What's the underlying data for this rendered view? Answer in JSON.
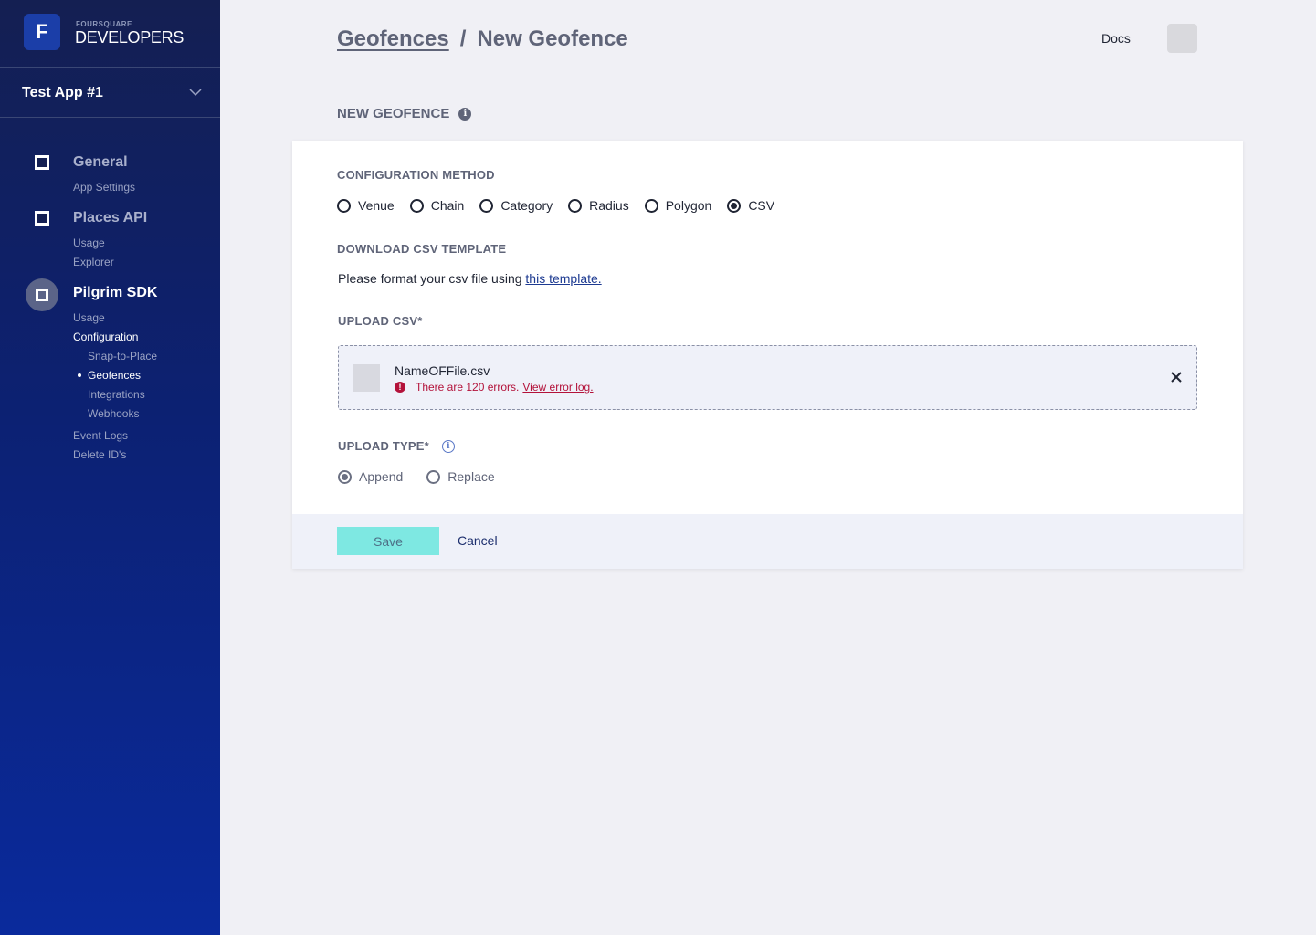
{
  "brand": {
    "logo_letter": "F",
    "small_text": "FOURSQUARE",
    "big_text": "DEVELOPERS"
  },
  "app_selector": {
    "label": "Test App #1"
  },
  "sidebar": {
    "general": {
      "title": "General",
      "items": [
        "App Settings"
      ]
    },
    "places": {
      "title": "Places API",
      "items": [
        "Usage",
        "Explorer"
      ]
    },
    "pilgrim": {
      "title": "Pilgrim SDK",
      "items": [
        "Usage",
        "Configuration"
      ],
      "config_items": [
        "Snap-to-Place",
        "Geofences",
        "Integrations",
        "Webhooks"
      ],
      "extra_items": [
        "Event Logs",
        "Delete ID's"
      ]
    }
  },
  "header": {
    "breadcrumb_parent": "Geofences",
    "separator": "/",
    "breadcrumb_current": "New Geofence",
    "docs": "Docs"
  },
  "page": {
    "section_title": "NEW GEOFENCE",
    "info_glyph": "i"
  },
  "form": {
    "config_label": "CONFIGURATION METHOD",
    "methods": [
      "Venue",
      "Chain",
      "Category",
      "Radius",
      "Polygon",
      "CSV"
    ],
    "selected_method": "CSV",
    "download_label": "DOWNLOAD CSV TEMPLATE",
    "template_text": "Please format your csv file using",
    "template_link": "this template.",
    "upload_label": "UPLOAD CSV*",
    "file_name": "NameOFFile.csv",
    "error_text": "There are 120 errors.",
    "error_link": "View error log.",
    "error_glyph": "!",
    "upload_type_label": "UPLOAD TYPE*",
    "upload_types": [
      "Append",
      "Replace"
    ],
    "selected_upload_type": "Append",
    "save": "Save",
    "cancel": "Cancel"
  },
  "colors": {
    "sidebar_top": "#141f52",
    "sidebar_bottom": "#0a2a9c",
    "save_button": "#7ee8e2",
    "error": "#b3123a",
    "link": "#1d3a91"
  }
}
